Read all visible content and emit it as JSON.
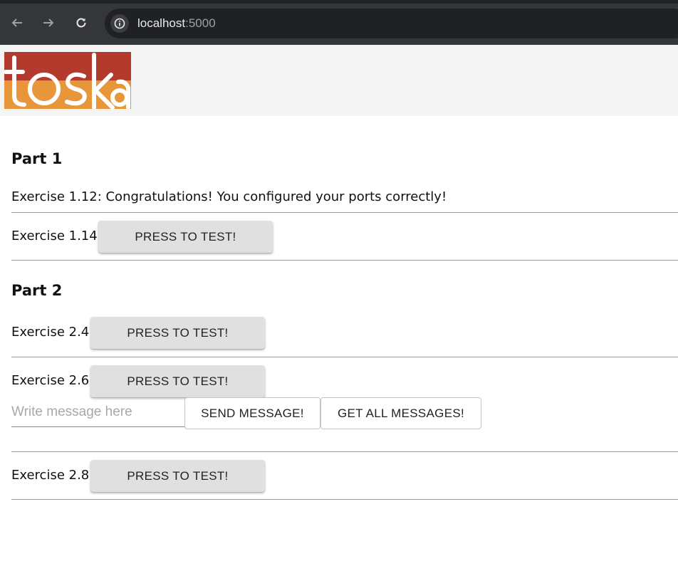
{
  "browser": {
    "url_host": "localhost",
    "url_port": ":5000",
    "icons": [
      "back-arrow-icon",
      "forward-arrow-icon",
      "reload-icon",
      "site-info-icon"
    ]
  },
  "logo": {
    "text": "toska",
    "colors": {
      "top": "#b53a2e",
      "bottom": "#e8963a"
    }
  },
  "part1": {
    "title": "Part 1",
    "ex_1_12": "Exercise 1.12: Congratulations! You configured your ports correctly!",
    "ex_1_14": {
      "label": "Exercise 1.14:",
      "button": "PRESS TO TEST!"
    }
  },
  "part2": {
    "title": "Part 2",
    "ex_2_4": {
      "label": "Exercise 2.4:",
      "button": "PRESS TO TEST!"
    },
    "ex_2_6": {
      "label": "Exercise 2.6:",
      "button": "PRESS TO TEST!",
      "input_placeholder": "Write message here",
      "send_button": "SEND MESSAGE!",
      "get_button": "GET ALL MESSAGES!"
    },
    "ex_2_8": {
      "label": "Exercise 2.8:",
      "button": "PRESS TO TEST!"
    }
  }
}
